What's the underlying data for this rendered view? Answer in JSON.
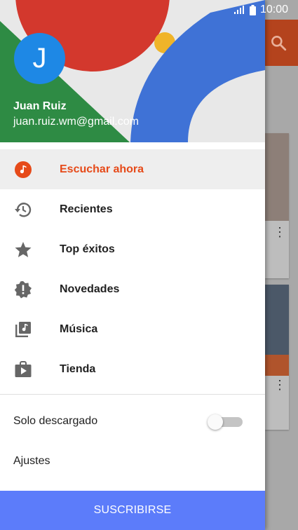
{
  "status_bar": {
    "time": "10:00"
  },
  "drawer": {
    "user": {
      "initial": "J",
      "name": "Juan Ruiz",
      "email": "juan.ruiz.wm@gmail.com"
    },
    "menu": [
      {
        "label": "Escuchar ahora",
        "icon": "listen-now-icon",
        "active": true
      },
      {
        "label": "Recientes",
        "icon": "history-icon",
        "active": false
      },
      {
        "label": "Top éxitos",
        "icon": "star-icon",
        "active": false
      },
      {
        "label": "Novedades",
        "icon": "new-releases-icon",
        "active": false
      },
      {
        "label": "Música",
        "icon": "music-library-icon",
        "active": false
      },
      {
        "label": "Tienda",
        "icon": "store-icon",
        "active": false
      }
    ],
    "settings": {
      "downloaded_only": {
        "label": "Solo descargado",
        "enabled": false
      },
      "settings_label": "Ajustes"
    },
    "subscribe_label": "SUSCRIBIRSE"
  },
  "colors": {
    "accent": "#e64a19",
    "subscribe": "#5c7cfa",
    "avatar": "#1e88e5"
  }
}
